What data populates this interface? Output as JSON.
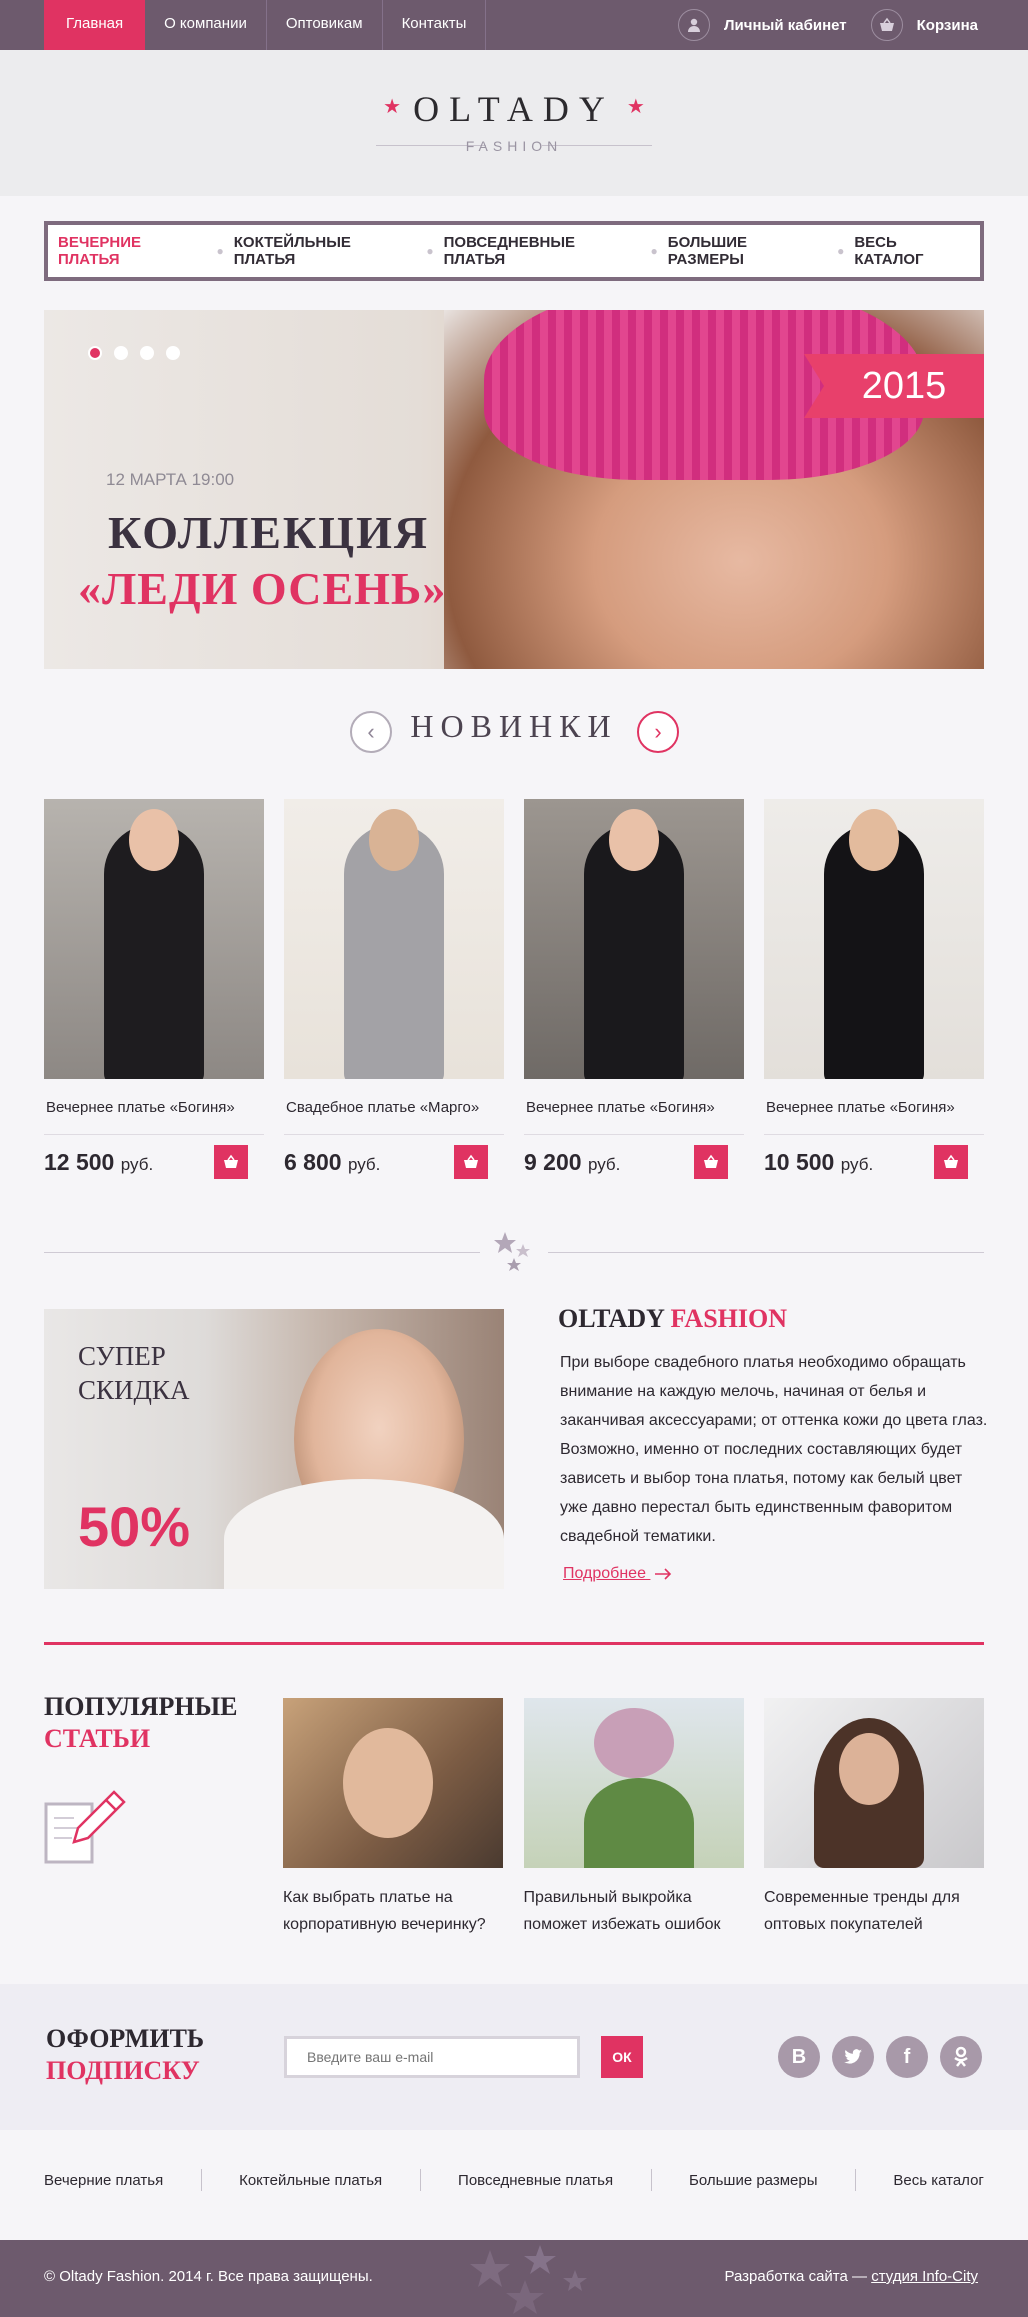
{
  "topbar": {
    "nav": [
      "Главная",
      "О компании",
      "Оптовикам",
      "Контакты"
    ],
    "account_label": "Личный кабинет",
    "cart_label": "Корзина"
  },
  "logo": {
    "name": "OLTADY",
    "sub": "FASHION"
  },
  "catnav": [
    "ВЕЧЕРНИЕ ПЛАТЬЯ",
    "КОКТЕЙЛЬНЫЕ ПЛАТЬЯ",
    "ПОВСЕДНЕВНЫЕ ПЛАТЬЯ",
    "БОЛЬШИЕ РАЗМЕРЫ",
    "ВЕСЬ КАТАЛОГ"
  ],
  "hero": {
    "ribbon": "2015",
    "date": "12 МАРТА 19:00",
    "title1": "КОЛЛЕКЦИЯ",
    "title2": "«ЛЕДИ ОСЕНЬ»",
    "slides": 4,
    "active_slide": 1
  },
  "news": {
    "title": "НОВИНКИ",
    "products": [
      {
        "name": "Вечернее платье «Богиня»",
        "price": "12 500",
        "currency": "руб."
      },
      {
        "name": "Свадебное платье «Марго»",
        "price": "6 800",
        "currency": "руб."
      },
      {
        "name": "Вечернее платье «Богиня»",
        "price": "9 200",
        "currency": "руб."
      },
      {
        "name": "Вечернее платье «Богиня»",
        "price": "10 500",
        "currency": "руб."
      }
    ]
  },
  "promo": {
    "line1": "СУПЕР",
    "line2": "СКИДКА",
    "percent": "50%"
  },
  "about": {
    "title_a": "OLTADY",
    "title_b": "FASHION",
    "text": "При выборе свадебного платья необходимо обращать внимание на каждую мелочь, начиная от белья и заканчивая аксессуарами; от оттенка кожи до цвета глаз. Возможно, именно от последних составляющих будет зависеть и выбор тона платья, потому как белый цвет уже давно перестал быть единственным фаворитом свадебной тематики.",
    "more": "Подробнее"
  },
  "articles": {
    "title1": "ПОПУЛЯРНЫЕ",
    "title2": "СТАТЬИ",
    "items": [
      {
        "caption": "Как выбрать платье на корпоративную вечеринку?"
      },
      {
        "caption": "Правильный выкройка поможет избежать ошибок"
      },
      {
        "caption": "Современные тренды для оптовых покупателей"
      }
    ]
  },
  "subscribe": {
    "title1": "ОФОРМИТЬ",
    "title2": "ПОДПИСКУ",
    "placeholder": "Введите ваш e-mail",
    "button": "ОК",
    "socials": [
      "vk-icon",
      "twitter-icon",
      "facebook-icon",
      "odnoklassniki-icon"
    ]
  },
  "footer": {
    "nav": [
      "Вечерние платья",
      "Коктейльные платья",
      "Повседневные платья",
      "Большие размеры",
      "Весь каталог"
    ],
    "copyright": "© Oltady Fashion. 2014 г. Все права защищены.",
    "dev_prefix": "Разработка сайта —",
    "dev_link": "студия Info-City"
  },
  "colors": {
    "accent": "#e03362",
    "plum": "#6d5a6d",
    "background": "#f6f5f8"
  }
}
